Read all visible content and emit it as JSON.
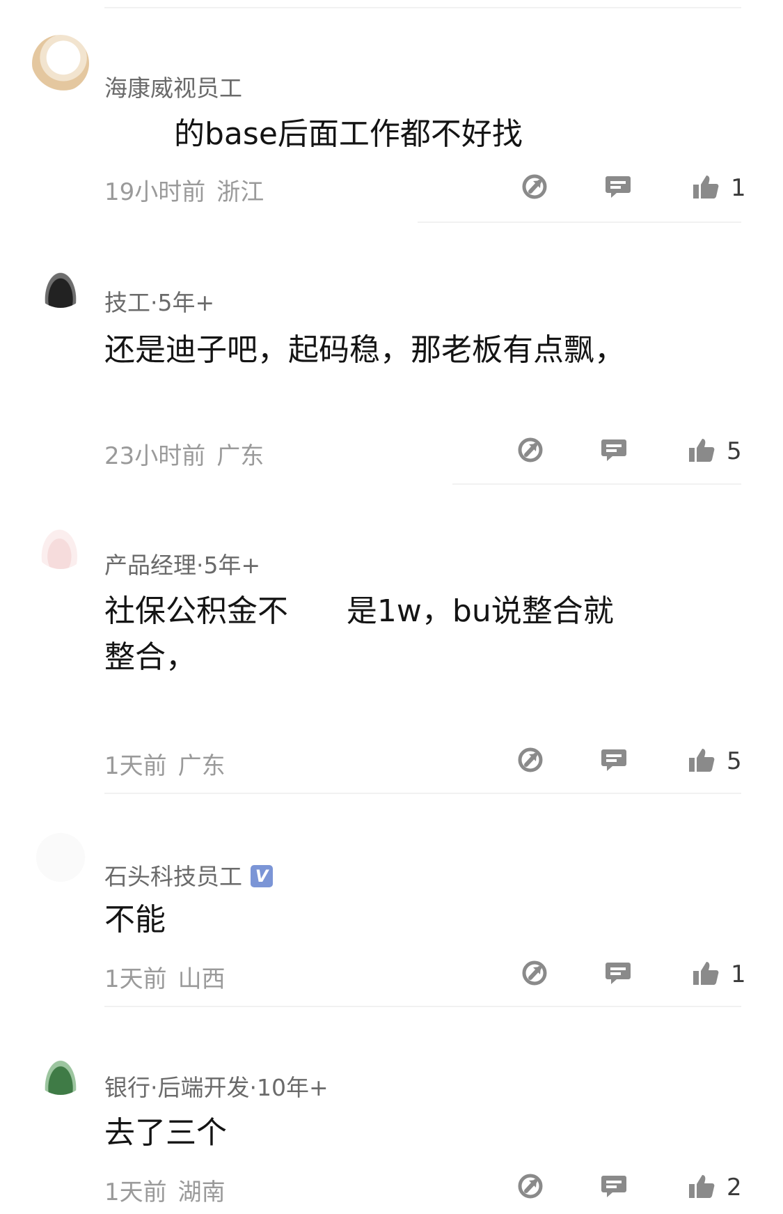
{
  "comments": [
    {
      "author": "海康威视员工",
      "content": "的base后面工作都不好找",
      "time": "19小时前",
      "region": "浙江",
      "likes": "1"
    },
    {
      "author": "技工·5年+",
      "content": "还是迪子吧，起码稳，那老板有点飘，",
      "time": "23小时前",
      "region": "广东",
      "likes": "5"
    },
    {
      "author": "产品经理·5年+",
      "content": "社保公积金不      是1w，bu说整合就\n整合，",
      "time": "1天前",
      "region": "广东",
      "likes": "5"
    },
    {
      "author": "石头科技员工",
      "verified_badge": "V",
      "content": "不能",
      "time": "1天前",
      "region": "山西",
      "likes": "1"
    },
    {
      "author": "银行·后端开发·10年+",
      "content": "去了三个",
      "time": "1天前",
      "region": "湖南",
      "likes": "2"
    }
  ],
  "icons": {
    "share": "share-icon",
    "reply": "comment-icon",
    "like": "thumbs-up-icon"
  },
  "colors": {
    "icon": "#8a8a8a",
    "author": "#6a6a6a",
    "meta": "#9a9a9a",
    "content": "#141414",
    "verified": "#7b95d6"
  }
}
